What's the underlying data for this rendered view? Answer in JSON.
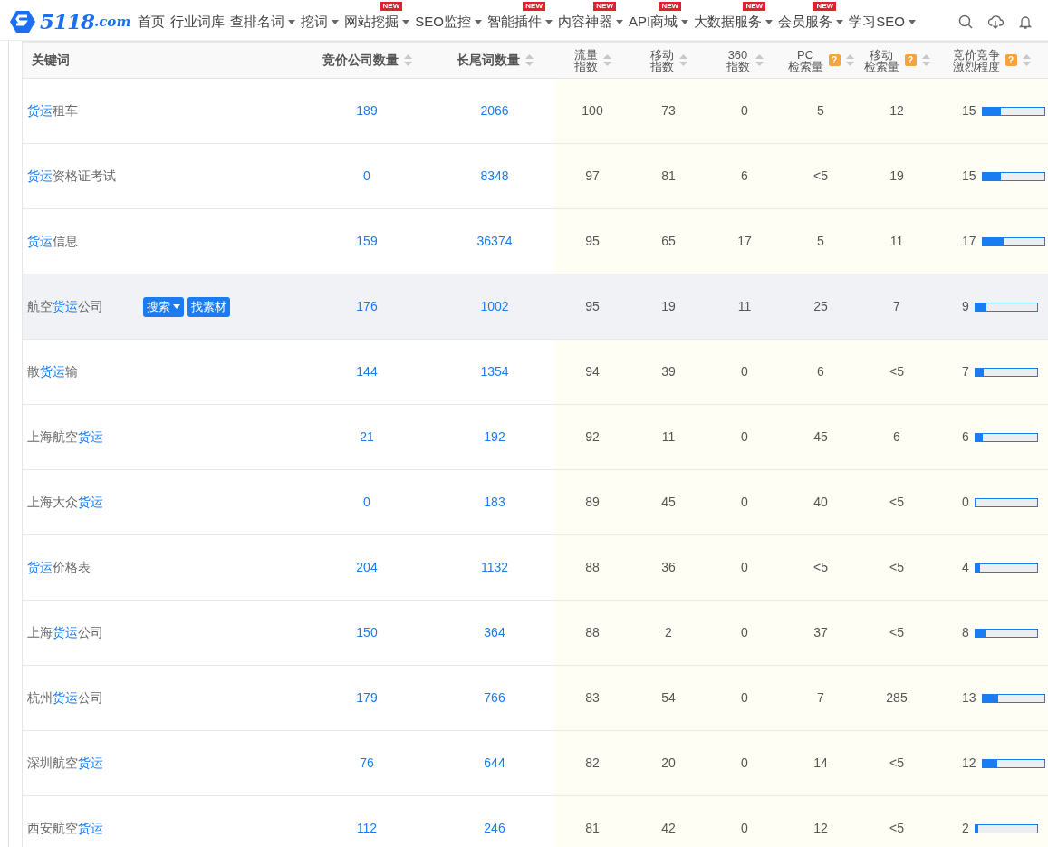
{
  "logo": {
    "text": "5118",
    "suffix": ".com"
  },
  "nav": [
    {
      "label": "首页",
      "dropdown": false,
      "new": false
    },
    {
      "label": "行业词库",
      "dropdown": false,
      "new": false
    },
    {
      "label": "查排名词",
      "dropdown": true,
      "new": false
    },
    {
      "label": "挖词",
      "dropdown": true,
      "new": false
    },
    {
      "label": "网站挖掘",
      "dropdown": true,
      "new": true,
      "badge": "NEW"
    },
    {
      "label": "SEO监控",
      "dropdown": true,
      "new": false
    },
    {
      "label": "智能插件",
      "dropdown": true,
      "new": true,
      "badge": "NEW"
    },
    {
      "label": "内容神器",
      "dropdown": true,
      "new": true,
      "badge": "NEW"
    },
    {
      "label": "API商城",
      "dropdown": true,
      "new": true,
      "badge": "NEW"
    },
    {
      "label": "大数据服务",
      "dropdown": true,
      "new": true,
      "badge": "NEW"
    },
    {
      "label": "会员服务",
      "dropdown": true,
      "new": true,
      "badge": "NEW"
    },
    {
      "label": "学习SEO",
      "dropdown": true,
      "new": false
    }
  ],
  "table": {
    "columns": [
      {
        "lines": [
          "关键词"
        ],
        "sortable": false,
        "help": false
      },
      {
        "lines": [
          "竞价公司数量"
        ],
        "sortable": true,
        "help": false
      },
      {
        "lines": [
          "长尾词数量"
        ],
        "sortable": true,
        "help": false
      },
      {
        "lines": [
          "流量",
          "指数"
        ],
        "sortable": true,
        "help": false
      },
      {
        "lines": [
          "移动",
          "指数"
        ],
        "sortable": true,
        "help": false
      },
      {
        "lines": [
          "360",
          "指数"
        ],
        "sortable": true,
        "help": false
      },
      {
        "lines": [
          "PC",
          "检索量"
        ],
        "sortable": true,
        "help": true,
        "help_text": "?"
      },
      {
        "lines": [
          "移动",
          "检索量"
        ],
        "sortable": true,
        "help": true,
        "help_text": "?"
      },
      {
        "lines": [
          "竞价竞争",
          "激烈程度"
        ],
        "sortable": true,
        "help": true,
        "help_text": "?"
      }
    ],
    "rows": [
      {
        "keyword": [
          {
            "text": "货运",
            "hl": true
          },
          {
            "text": "租车",
            "hl": false
          }
        ],
        "bid": "189",
        "longtail": "2066",
        "flow": "100",
        "mobile": "73",
        "i360": "0",
        "pc": "5",
        "mob_search": "12",
        "competition": "15",
        "level": 0.3,
        "highlighted": false
      },
      {
        "keyword": [
          {
            "text": "货运",
            "hl": true
          },
          {
            "text": "资格证考试",
            "hl": false
          }
        ],
        "bid": "0",
        "longtail": "8348",
        "flow": "97",
        "mobile": "81",
        "i360": "6",
        "pc": "<5",
        "mob_search": "19",
        "competition": "15",
        "level": 0.3,
        "highlighted": false
      },
      {
        "keyword": [
          {
            "text": "货运",
            "hl": true
          },
          {
            "text": "信息",
            "hl": false
          }
        ],
        "bid": "159",
        "longtail": "36374",
        "flow": "95",
        "mobile": "65",
        "i360": "17",
        "pc": "5",
        "mob_search": "11",
        "competition": "17",
        "level": 0.34,
        "highlighted": false
      },
      {
        "keyword": [
          {
            "text": "航空",
            "hl": false
          },
          {
            "text": "货运",
            "hl": true
          },
          {
            "text": "公司",
            "hl": false
          }
        ],
        "bid": "176",
        "longtail": "1002",
        "flow": "95",
        "mobile": "19",
        "i360": "11",
        "pc": "25",
        "mob_search": "7",
        "competition": "9",
        "level": 0.18,
        "highlighted": true,
        "actions": [
          {
            "label": "搜索",
            "dropdown": true
          },
          {
            "label": "找素材",
            "dropdown": false
          }
        ]
      },
      {
        "keyword": [
          {
            "text": "散",
            "hl": false
          },
          {
            "text": "货运",
            "hl": true
          },
          {
            "text": "输",
            "hl": false
          }
        ],
        "bid": "144",
        "longtail": "1354",
        "flow": "94",
        "mobile": "39",
        "i360": "0",
        "pc": "6",
        "mob_search": "<5",
        "competition": "7",
        "level": 0.14,
        "highlighted": false
      },
      {
        "keyword": [
          {
            "text": "上海航空",
            "hl": false
          },
          {
            "text": "货运",
            "hl": true
          }
        ],
        "bid": "21",
        "longtail": "192",
        "flow": "92",
        "mobile": "11",
        "i360": "0",
        "pc": "45",
        "mob_search": "6",
        "competition": "6",
        "level": 0.12,
        "highlighted": false
      },
      {
        "keyword": [
          {
            "text": "上海大众",
            "hl": false
          },
          {
            "text": "货运",
            "hl": true
          }
        ],
        "bid": "0",
        "longtail": "183",
        "flow": "89",
        "mobile": "45",
        "i360": "0",
        "pc": "40",
        "mob_search": "<5",
        "competition": "0",
        "level": 0,
        "highlighted": false
      },
      {
        "keyword": [
          {
            "text": "货运",
            "hl": true
          },
          {
            "text": "价格表",
            "hl": false
          }
        ],
        "bid": "204",
        "longtail": "1132",
        "flow": "88",
        "mobile": "36",
        "i360": "0",
        "pc": "<5",
        "mob_search": "<5",
        "competition": "4",
        "level": 0.08,
        "highlighted": false
      },
      {
        "keyword": [
          {
            "text": "上海",
            "hl": false
          },
          {
            "text": "货运",
            "hl": true
          },
          {
            "text": "公司",
            "hl": false
          }
        ],
        "bid": "150",
        "longtail": "364",
        "flow": "88",
        "mobile": "2",
        "i360": "0",
        "pc": "37",
        "mob_search": "<5",
        "competition": "8",
        "level": 0.16,
        "highlighted": false
      },
      {
        "keyword": [
          {
            "text": "杭州",
            "hl": false
          },
          {
            "text": "货运",
            "hl": true
          },
          {
            "text": "公司",
            "hl": false
          }
        ],
        "bid": "179",
        "longtail": "766",
        "flow": "83",
        "mobile": "54",
        "i360": "0",
        "pc": "7",
        "mob_search": "285",
        "competition": "13",
        "level": 0.26,
        "highlighted": false
      },
      {
        "keyword": [
          {
            "text": "深圳航空",
            "hl": false
          },
          {
            "text": "货运",
            "hl": true
          }
        ],
        "bid": "76",
        "longtail": "644",
        "flow": "82",
        "mobile": "20",
        "i360": "0",
        "pc": "14",
        "mob_search": "<5",
        "competition": "12",
        "level": 0.24,
        "highlighted": false
      },
      {
        "keyword": [
          {
            "text": "西安航空",
            "hl": false
          },
          {
            "text": "货运",
            "hl": true
          }
        ],
        "bid": "112",
        "longtail": "246",
        "flow": "81",
        "mobile": "42",
        "i360": "0",
        "pc": "12",
        "mob_search": "<5",
        "competition": "2",
        "level": 0.04,
        "highlighted": false
      }
    ]
  }
}
